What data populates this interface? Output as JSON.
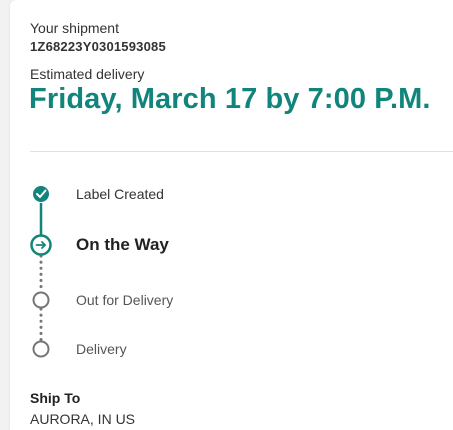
{
  "shipment": {
    "label": "Your shipment",
    "tracking_number": "1Z68223Y0301593085"
  },
  "delivery": {
    "label": "Estimated delivery",
    "date_text": "Friday, March 17 by 7:00 P.M."
  },
  "progress": {
    "current_step_index": 1,
    "steps": [
      {
        "label": "Label Created",
        "status": "completed",
        "icon": "check-icon"
      },
      {
        "label": "On the Way",
        "status": "current",
        "icon": "arrow-right-icon"
      },
      {
        "label": "Out for Delivery",
        "status": "pending",
        "icon": "empty-circle-icon"
      },
      {
        "label": "Delivery",
        "status": "pending",
        "icon": "empty-circle-icon"
      }
    ]
  },
  "ship_to": {
    "label": "Ship To",
    "value": "AURORA, IN US"
  },
  "colors": {
    "accent": "#11857b",
    "text": "#333333",
    "pending": "#757575"
  }
}
